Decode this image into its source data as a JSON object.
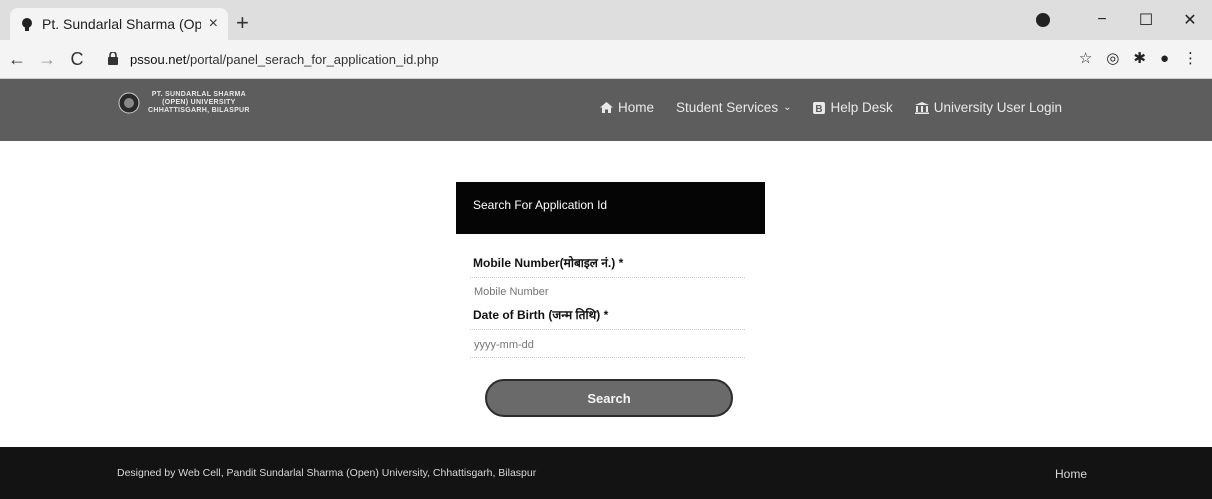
{
  "browser": {
    "tab_title": "Pt. Sundarlal Sharma (Ope",
    "close": "×",
    "new_tab": "+",
    "url_domain": "pssou.net",
    "url_path": "/portal/panel_serach_for_application_id.php",
    "minimize": "−",
    "maximize": "☐",
    "close_window": "✕"
  },
  "header": {
    "logo_lines": [
      "PT. SUNDARLAL SHARMA",
      "(OPEN) UNIVERSITY",
      "CHHATTISGARH, BILASPUR"
    ],
    "nav": {
      "home": "Home",
      "student_services": "Student Services",
      "help_desk": "Help Desk",
      "university_login": "University User Login"
    }
  },
  "form": {
    "heading": "Search For Application Id",
    "mobile_label": "Mobile Number(मोबाइल नं.) *",
    "mobile_placeholder": "Mobile Number",
    "dob_label": "Date of Birth (जन्म तिथि) *",
    "dob_placeholder": "yyyy-mm-dd",
    "search_button": "Search"
  },
  "footer": {
    "credit": "Designed by Web Cell, Pandit Sundarlal Sharma (Open) University, Chhattisgarh, Bilaspur",
    "home_link": "Home"
  }
}
